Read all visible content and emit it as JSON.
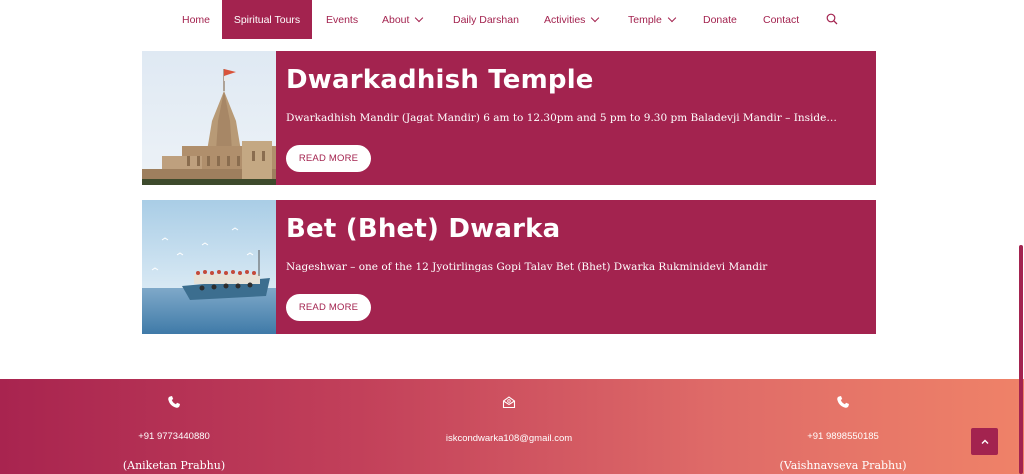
{
  "nav": {
    "items": [
      {
        "label": "Home"
      },
      {
        "label": "Spiritual Tours"
      },
      {
        "label": "Events"
      },
      {
        "label": "About"
      },
      {
        "label": "Daily Darshan"
      },
      {
        "label": "Activities"
      },
      {
        "label": "Temple"
      },
      {
        "label": "Donate"
      },
      {
        "label": "Contact"
      }
    ],
    "search_icon": "search-icon",
    "active": "Spiritual Tours"
  },
  "cards": [
    {
      "title": "Dwarkadhish Temple",
      "excerpt": "Dwarkadhish Mandir (Jagat Mandir) 6 am to 12.30pm and 5 pm to 9.30 pm Baladevji Mandir – Inside…",
      "button": "READ MORE"
    },
    {
      "title": "Bet (Bhet) Dwarka",
      "excerpt": "Nageshwar – one of the 12 Jyotirlingas Gopi Talav Bet (Bhet) Dwarka Rukminidevi Mandir",
      "button": "READ MORE"
    }
  ],
  "footer": {
    "contacts": [
      {
        "icon": "phone-icon",
        "line1": "+91 9773440880",
        "line2": "(Aniketan Prabhu)"
      },
      {
        "icon": "envelope-icon",
        "line1": "iskcondwarka108@gmail.com",
        "line2": ""
      },
      {
        "icon": "phone-icon",
        "line1": "+91 9898550185",
        "line2": "(Vaishnavseva Prabhu)"
      }
    ]
  },
  "colors": {
    "brand": "#a3234f",
    "footer_gradient_start": "#a8244f",
    "footer_gradient_end": "#ef8268"
  }
}
